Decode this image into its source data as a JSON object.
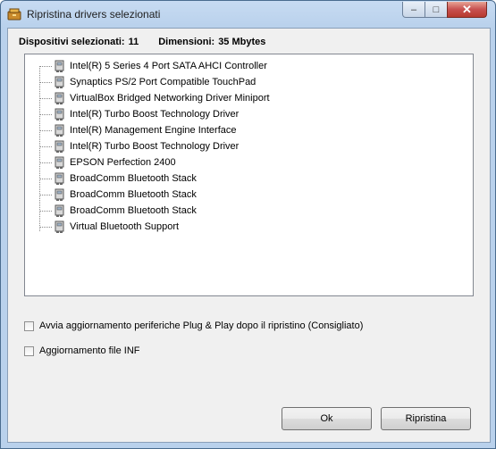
{
  "window": {
    "title": "Ripristina drivers selezionati",
    "controls": {
      "minimize": "–",
      "maximize": "□",
      "close": "✕"
    }
  },
  "summary": {
    "devices_label": "Dispositivi selezionati:",
    "devices_count": "11",
    "size_label": "Dimensioni:",
    "size_value": "35 Mbytes"
  },
  "devices": [
    {
      "label": "Intel(R) 5 Series 4 Port SATA AHCI Controller",
      "icon": "device-icon"
    },
    {
      "label": "Synaptics PS/2 Port Compatible TouchPad",
      "icon": "device-icon"
    },
    {
      "label": "VirtualBox Bridged Networking Driver Miniport",
      "icon": "device-icon"
    },
    {
      "label": "Intel(R) Turbo Boost Technology Driver",
      "icon": "device-icon"
    },
    {
      "label": "Intel(R) Management Engine Interface",
      "icon": "device-icon"
    },
    {
      "label": "Intel(R) Turbo Boost Technology Driver",
      "icon": "device-icon"
    },
    {
      "label": "EPSON Perfection 2400",
      "icon": "device-icon"
    },
    {
      "label": "BroadComm Bluetooth Stack",
      "icon": "device-icon"
    },
    {
      "label": "BroadComm Bluetooth Stack",
      "icon": "device-icon"
    },
    {
      "label": "BroadComm Bluetooth Stack",
      "icon": "device-icon"
    },
    {
      "label": "Virtual Bluetooth Support",
      "icon": "device-icon"
    }
  ],
  "options": {
    "pnp_update": {
      "label": "Avvia aggiornamento periferiche Plug & Play dopo il ripristino (Consigliato)",
      "checked": false
    },
    "inf_update": {
      "label": "Aggiornamento file INF",
      "checked": false
    }
  },
  "buttons": {
    "ok": "Ok",
    "restore": "Ripristina"
  }
}
